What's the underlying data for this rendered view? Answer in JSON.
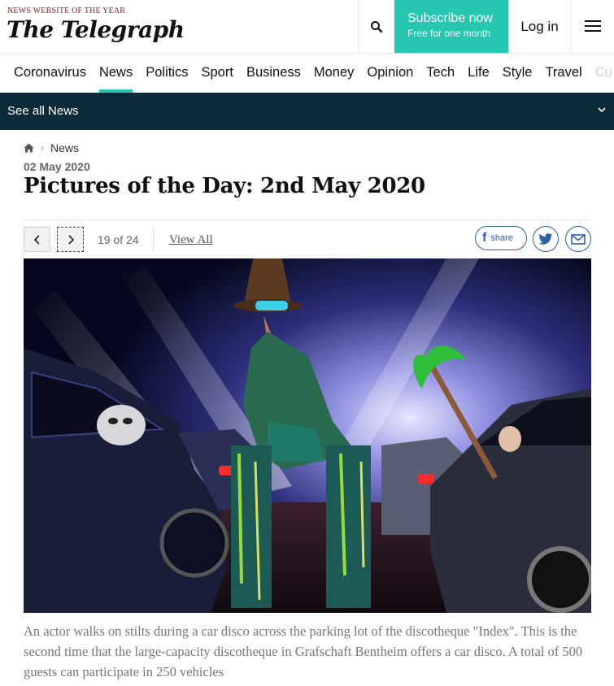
{
  "header": {
    "tagline": "NEWS WEBSITE OF THE YEAR",
    "logo": "The Telegraph",
    "search_icon": "search-icon",
    "subscribe": {
      "main": "Subscribe now",
      "sub": "Free for one month"
    },
    "login": "Log in",
    "menu_icon": "hamburger-menu-icon",
    "brand_color": "#26c6b0"
  },
  "nav": {
    "items": [
      {
        "label": "Coronavirus"
      },
      {
        "label": "News"
      },
      {
        "label": "Politics"
      },
      {
        "label": "Sport"
      },
      {
        "label": "Business"
      },
      {
        "label": "Money"
      },
      {
        "label": "Opinion"
      },
      {
        "label": "Tech"
      },
      {
        "label": "Life"
      },
      {
        "label": "Style"
      },
      {
        "label": "Travel"
      },
      {
        "label": "Cu"
      }
    ],
    "active": "News"
  },
  "section_bar": {
    "label": "See all News",
    "bg_color": "#0c2a37"
  },
  "breadcrumb": {
    "home_icon": "home-icon",
    "item": "News"
  },
  "article": {
    "date": "02 May 2020",
    "title": "Pictures of the Day: 2nd May 2020"
  },
  "gallery": {
    "counter": "19 of 24",
    "view_all": "View All",
    "share_label": "share",
    "caption": "An actor walks on stilts during a car disco across the parking lot of the discotheque \"Index\". This is the second time that the large-capacity discotheque in Grafschaft Bentheim offers a car disco. A total of 500 guests can participate in 250 vehicles"
  }
}
